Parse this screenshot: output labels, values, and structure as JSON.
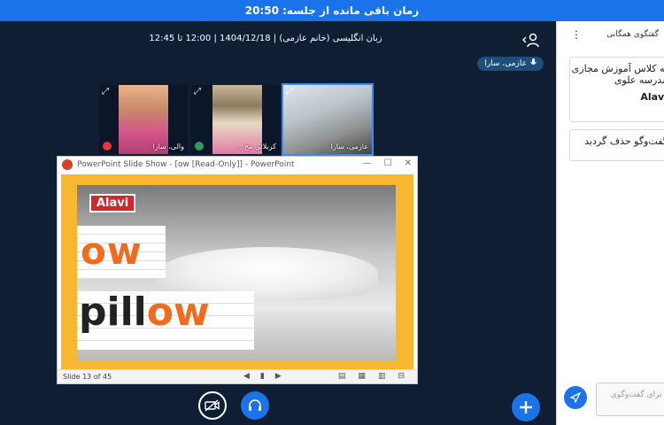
{
  "topbar": {
    "timer_text": "زمان باقی مانده از جلسه: 20:50"
  },
  "meeting": {
    "title": "زبان انگلیسی (خانم عازمی) | 1404/12/18 | 12:00 تا 12:45"
  },
  "presenter": {
    "name": "عازمی، سارا"
  },
  "participants": [
    {
      "name": "والی، سارا",
      "mic_color": "#e53935"
    },
    {
      "name": "کربلائی مح...",
      "mic_color": "#2e9b5e"
    },
    {
      "name": "عازمی، سارا",
      "mic_color": "#1a73e8"
    }
  ],
  "powerpoint": {
    "window_title": "PowerPoint Slide Show - [ow [Read-Only]] - PowerPoint",
    "slide_status": "Slide 13 of 45",
    "slide": {
      "logo_text": "Alavi",
      "word_part": "ow",
      "word_prefix": "pill",
      "word_suffix": "ow"
    }
  },
  "chat": {
    "header_title": "گفتگوی همگانی",
    "card1_line1": "به کلاس آموزش مجازی",
    "card1_line2": "مدرسه علوی",
    "card1_line3": "Alavi",
    "card2_text": "گفت‌وگو حذف گردید",
    "input_placeholder": "پیام برای گفت‌وگوی"
  },
  "colors": {
    "accent": "#1a73e8",
    "background": "#0f1e33",
    "slide_frame": "#f7b731",
    "slide_orange": "#f26b1d"
  }
}
